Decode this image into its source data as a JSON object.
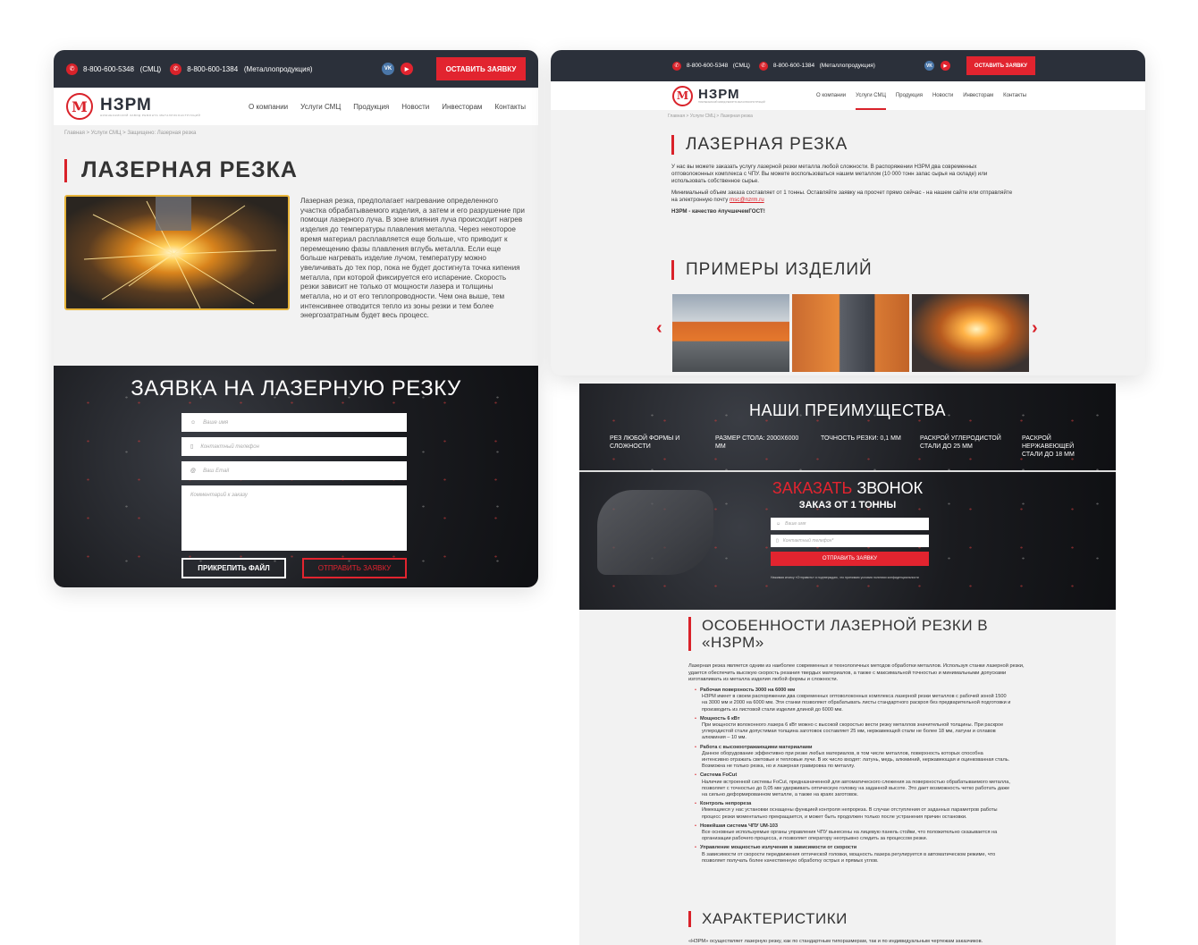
{
  "left": {
    "topbar": {
      "phone1": "8-800-600-5348",
      "phone1_note": "(СМЦ)",
      "phone2": "8-800-600-1384",
      "phone2_note": "(Металлопродукция)",
      "vk": "VK",
      "youtube": "▶",
      "cta": "ОСТАВИТЬ ЗАЯВКУ"
    },
    "logo": {
      "mark": "М",
      "word": "НЗРМ",
      "tagline": "НИЖНЕКАМСКИЙ ЗАВОД РЕМОНТА МЕТАЛЛОКОНСТРУКЦИЙ"
    },
    "nav": [
      "О компании",
      "Услуги СМЦ",
      "Продукция",
      "Новости",
      "Инвесторам",
      "Контакты"
    ],
    "breadcrumbs": "Главная > Услуги СМЦ > Защищено: Лазерная резка",
    "title": "ЛАЗЕРНАЯ РЕЗКА",
    "description": "Лазерная резка, предполагает нагревание определенного участка обрабатываемого изделия, а затем и его разрушение при помощи лазерного луча. В зоне влияния луча происходит нагрев изделия до температуры плавления металла. Через некоторое время материал расплавляется еще больше, что приводит к перемещению фазы плавления вглубь металла. Если еще больше нагревать изделие лучом, температуру можно увеличивать до тех пор, пока не будет достигнута точка кипения металла, при которой фиксируется его испарение. Скорость резки зависит не только от мощности лазера и толщины металла, но и от его теплопроводности. Чем она выше, тем интенсивнее отводится тепло из зоны резки и тем более энергозатратным будет весь процесс.",
    "form": {
      "title": "ЗАЯВКА НА ЛАЗЕРНУЮ РЕЗКУ",
      "name_placeholder": "Ваше имя",
      "phone_placeholder": "Контактный телефон",
      "email_placeholder": "Ваш Email",
      "comment_placeholder": "Комментарий к заказу",
      "attach": "ПРИКРЕПИТЬ ФАЙЛ",
      "submit": "ОТПРАВИТЬ ЗАЯВКУ"
    }
  },
  "right": {
    "topbar": {
      "phone1": "8-800-600-5348",
      "phone1_note": "(СМЦ)",
      "phone2": "8-800-600-1384",
      "phone2_note": "(Металлопродукция)",
      "vk": "VK",
      "youtube": "▶",
      "cta": "ОСТАВИТЬ ЗАЯВКУ"
    },
    "logo": {
      "mark": "М",
      "word": "НЗРМ",
      "tagline": "НИЖНЕКАМСКИЙ ЗАВОД РЕМОНТА МЕТАЛЛОКОНСТРУКЦИЙ"
    },
    "nav": [
      "О компании",
      "Услуги СМЦ",
      "Продукция",
      "Новости",
      "Инвесторам",
      "Контакты"
    ],
    "nav_active": "Услуги СМЦ",
    "breadcrumbs": "Главная > Услуги СМЦ > Лазерная резка",
    "title": "ЛАЗЕРНАЯ РЕЗКА",
    "intro1": "У нас вы можете заказать услугу лазерной резки металла любой сложности. В распоряжении НЗРМ два современных оптоволоконных комплекса с ЧПУ. Вы можете воспользоваться нашим металлом (10 000 тонн запас сырья на складе) или использовать собственное сырье.",
    "intro2": "Минимальный объем заказа составляет от 1 тонны. Оставляйте заявку на просчет прямо сейчас - на нашем сайте или отправляйте на электронную почту",
    "email": "msc@nzrm.ru",
    "slogan": "НЗРМ - качество #лучшечемГОСТ!",
    "examples_title": "ПРИМЕРЫ ИЗДЕЛИЙ",
    "prev": "‹",
    "next": "›"
  },
  "advantages": {
    "title": "НАШИ ПРЕИМУЩЕСТВА",
    "items": [
      "РЕЗ ЛЮБОЙ ФОРМЫ И СЛОЖНОСТИ",
      "РАЗМЕР СТОЛА: 2000Х6000 ММ",
      "ТОЧНОСТЬ РЕЗКИ: 0,1 ММ",
      "РАСКРОЙ УГЛЕРОДИСТОЙ СТАЛИ ДО 25 ММ",
      "РАСКРОЙ НЕРЖАВЕЮЩЕЙ СТАЛИ ДО 18 ММ"
    ]
  },
  "callback": {
    "title_accent": "ЗАКАЗАТЬ",
    "title_rest": "ЗВОНОК",
    "subtitle": "ЗАКАЗ ОТ 1 ТОННЫ",
    "name_placeholder": "Ваше имя",
    "phone_placeholder": "Контактный телефон*",
    "submit": "ОТПРАВИТЬ ЗАЯВКУ",
    "consent": "Нажимая кнопку «Отправить» я подтверждаю, что принимаю условия политики конфиденциальности"
  },
  "features": {
    "title": "ОСОБЕННОСТИ ЛАЗЕРНОЙ РЕЗКИ В «НЗРМ»",
    "intro": "Лазерная резка является одним из наиболее современных и технологичных методов обработки металлов. Используя станки лазерной резки, удается обеспечить высокую скорость резания твердых материалов, а также с максимальной точностью и минимальными допусками изготавливать из металла изделия любой формы и сложности.",
    "items": [
      {
        "head": "Рабочая поверхность 3000 на 6000 мм",
        "text": "НЗРМ имеет в своем распоряжении два современных оптоволоконных комплекса лазерной резки металлов с рабочей зоной 1500 на 3000 мм и 2000 на 6000 мм. Эти станки позволяют обрабатывать листы стандартного раскроя без предварительной подготовки и производить из листовой стали изделия длиной до 6000 мм."
      },
      {
        "head": "Мощность 6 кВт",
        "text": "При мощности волоконного лазера 6 кВт можно с высокой скоростью вести резку металлов значительной толщины. При раскрое углеродистой стали допустимая толщина заготовок составляет 25 мм, нержавеющей стали не более 18 мм, латуни и сплавов алюминия – 10 мм."
      },
      {
        "head": "Работа с высокоотражающими материалами",
        "text": "Данное оборудование эффективно при резке любых материалов, в том числе металлов, поверхность которых способна интенсивно отражать световые и тепловые лучи. В их число входят: латунь, медь, алюминий, нержавеющая и оцинкованная сталь. Возможна не только резка, но и лазерная гравировка по металлу."
      },
      {
        "head": "Система FoCut",
        "text": "Наличие встроенной системы FoCut, предназначенной для автоматического слежения за поверхностью обрабатываемого металла, позволяет с точностью до 0,05 мм удерживать оптическую головку на заданной высоте. Это дает возможность четко работать даже на сильно деформированном металле, а также на краях заготовок."
      },
      {
        "head": "Контроль непрореза",
        "text": "Имеющиеся у нас установки оснащены функцией контроля непрореза. В случае отступления от заданных параметров работы процесс резки моментально прекращается, и может быть продолжен только после устранения причин остановки."
      },
      {
        "head": "Новейшая система ЧПУ UM-103",
        "text": "Все основные используемые органы управления ЧПУ вынесены на лицевую панель стойки, что положительно сказывается на организации рабочего процесса, и позволяет оператору неотрывно следить за процессом резки."
      },
      {
        "head": "Управление мощностью излучения в зависимости от скорости",
        "text": "В зависимости от скорости передвижения оптической головки, мощность лазера регулируется в автоматическом режиме, что позволяет получать более качественную обработку острых и прямых углов."
      }
    ]
  },
  "specs": {
    "title": "ХАРАКТЕРИСТИКИ",
    "intro": "«НЗРМ» осуществляет лазерную резку, как по стандартным типоразмерам, так и по индивидуальным чертежам заказчиков."
  }
}
